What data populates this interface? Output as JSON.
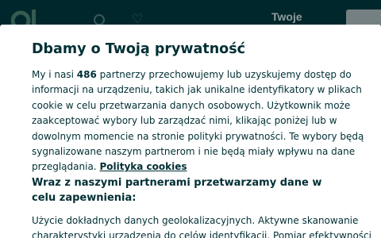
{
  "header": {
    "label": "Twoje"
  },
  "dialog": {
    "title": "Dbamy o Twoją prywatność",
    "intro_before_count": "My i nasi ",
    "partner_count": "486",
    "intro_after_count": " partnerzy przechowujemy lub uzyskujemy dostęp do informacji na urządzeniu, takich jak unikalne identyfikatory w plikach cookie w celu przetwarzania danych osobowych. Użytkownik może zaakceptować wybory lub zarządzać nimi, klikając poniżej lub w dowolnym momencie na stronie polityki prywatności. Te wybory będą sygnalizowane naszym partnerom i nie będą miały wpływu na dane przeglądania. ",
    "policy_link": "Polityka cookies",
    "purposes_heading": "Wraz z naszymi partnerami przetwarzamy dane w celu zapewnienia:",
    "purposes_text": "Użycie dokładnych danych geolokalizacyjnych. Aktywne skanowanie charakterystyki urządzenia do celów identyfikacji. Pomiar efektywności"
  },
  "colors": {
    "brand_dark": "#002f34",
    "text": "#002f34"
  }
}
